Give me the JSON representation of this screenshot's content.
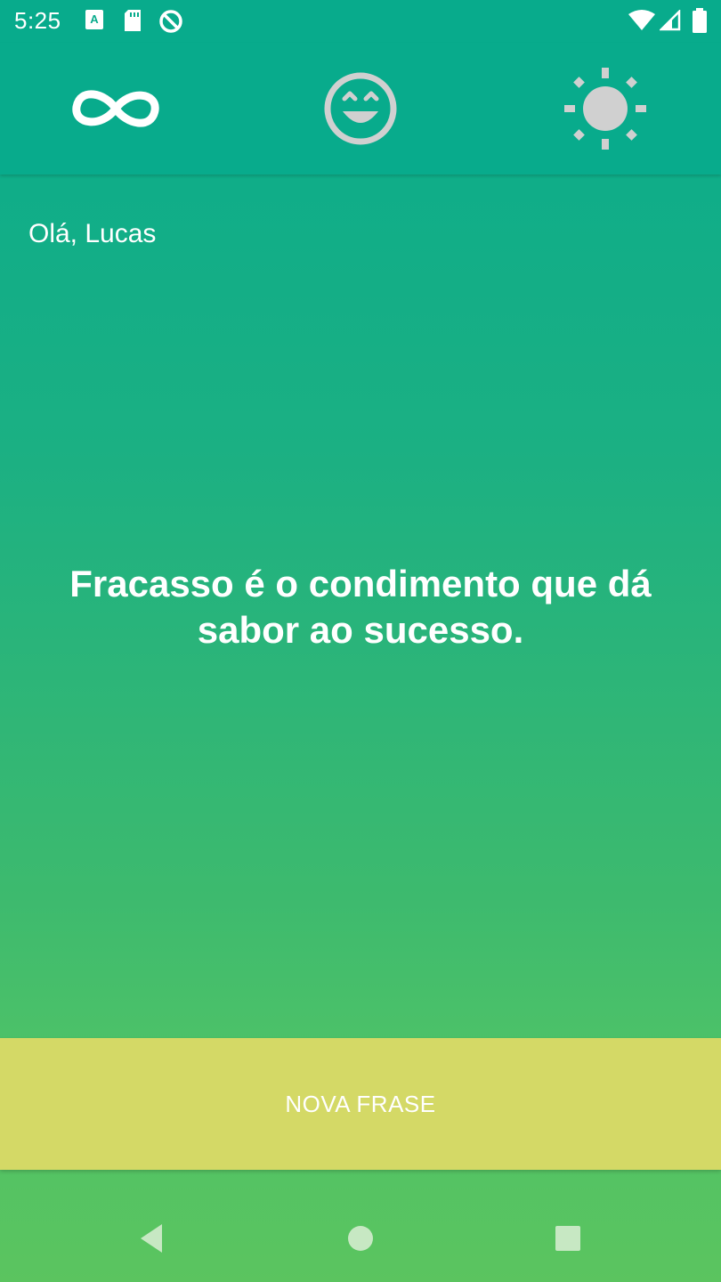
{
  "status_bar": {
    "time": "5:25",
    "left_icons": [
      "font-download-icon",
      "sd-card-icon",
      "sync-disabled-icon"
    ],
    "right_icons": [
      "wifi-icon",
      "signal-icon",
      "battery-icon"
    ]
  },
  "tabs": [
    {
      "name": "infinity",
      "icon": "infinity-icon",
      "selected": true
    },
    {
      "name": "mood",
      "icon": "smiley-icon",
      "selected": false
    },
    {
      "name": "sun",
      "icon": "sun-icon",
      "selected": false
    }
  ],
  "main": {
    "greeting": "Olá, Lucas",
    "quote": "Fracasso é o condimento que dá sabor ao sucesso."
  },
  "action": {
    "new_phrase_label": "NOVA FRASE"
  },
  "navigation": {
    "icons": [
      "back-icon",
      "home-icon",
      "recents-icon"
    ]
  },
  "colors": {
    "header": "#08ab8c",
    "button": "#d4d966",
    "icon_inactive": "#d0d0d0",
    "text": "#ffffff"
  }
}
